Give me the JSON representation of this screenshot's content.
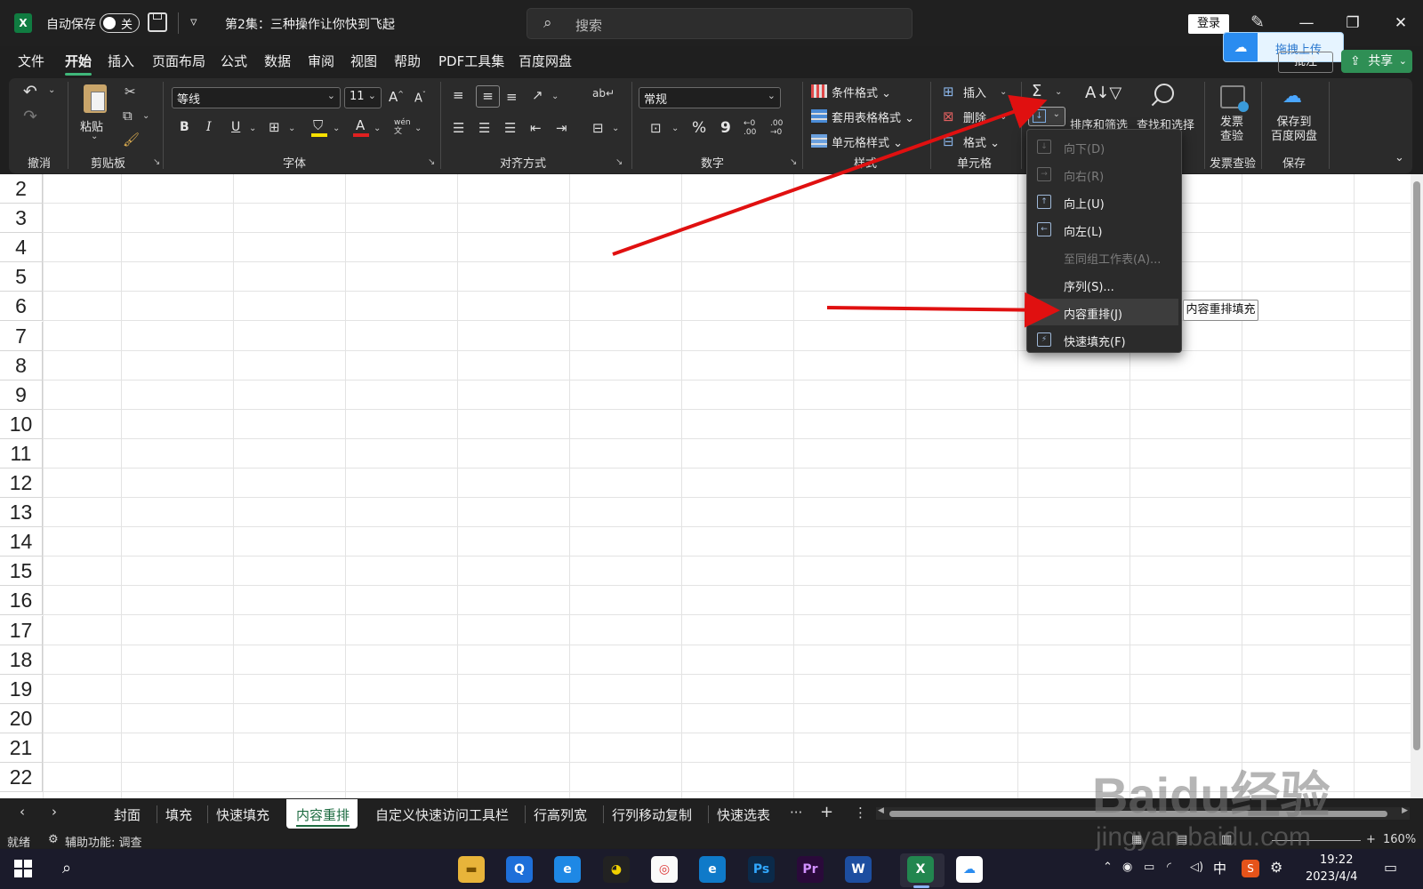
{
  "titlebar": {
    "logo": "X",
    "autosave_label": "自动保存",
    "autosave_state": "关",
    "document_title": "第2集：三种操作让你快到飞起",
    "search_placeholder": "搜索",
    "login_label": "登录",
    "minimize": "—",
    "restore": "❐",
    "close": "✕"
  },
  "menu_tabs": [
    "文件",
    "开始",
    "插入",
    "页面布局",
    "公式",
    "数据",
    "审阅",
    "视图",
    "帮助",
    "PDF工具集",
    "百度网盘"
  ],
  "active_tab": "开始",
  "baidu_popup": {
    "label": "拖拽上传"
  },
  "comment_button": "批注",
  "share_button": "共享",
  "ribbon": {
    "groups": {
      "undo": "撤消",
      "clipboard": "剪贴板",
      "font": "字体",
      "alignment": "对齐方式",
      "number": "数字",
      "styles": "样式",
      "cells": "单元格",
      "invoice": "发票查验",
      "save": "保存"
    },
    "paste_label": "粘贴",
    "font_name": "等线",
    "font_size": "11",
    "number_format": "常规",
    "conditional_format": "条件格式",
    "table_format": "套用表格格式",
    "cell_styles": "单元格样式",
    "insert": "插入",
    "delete": "删除",
    "format": "格式",
    "sort_filter": "排序和筛选",
    "find_select": "查找和选择",
    "invoice_line1": "发票",
    "invoice_line2": "查验",
    "save_baidu_line1": "保存到",
    "save_baidu_line2": "百度网盘",
    "bold": "B",
    "italic": "I",
    "underline": "U",
    "percent": "%",
    "comma": "9"
  },
  "fill_menu": {
    "items": [
      {
        "label": "向下(D)",
        "disabled": true
      },
      {
        "label": "向右(R)",
        "disabled": true
      },
      {
        "label": "向上(U)",
        "disabled": false
      },
      {
        "label": "向左(L)",
        "disabled": false
      },
      {
        "label": "至同组工作表(A)...",
        "disabled": true
      },
      {
        "label": "序列(S)...",
        "disabled": false
      },
      {
        "label": "内容重排(J)",
        "disabled": false
      },
      {
        "label": "快速填充(F)",
        "disabled": false
      }
    ],
    "tooltip": "内容重排填充"
  },
  "row_numbers": [
    "2",
    "3",
    "4",
    "5",
    "6",
    "7",
    "8",
    "9",
    "10",
    "11",
    "12",
    "13",
    "14",
    "15",
    "16",
    "17",
    "18",
    "19",
    "20",
    "21",
    "22"
  ],
  "sheet_tabs": [
    "封面",
    "填充",
    "快速填充",
    "内容重排",
    "自定义快速访问工具栏",
    "行高列宽",
    "行列移动复制",
    "快速选表"
  ],
  "active_sheet": "内容重排",
  "sheet_more": "···",
  "sheet_add": "+",
  "status": {
    "ready": "就绪",
    "accessibility": "辅助功能: 调查",
    "zoom": "160%"
  },
  "taskbar": {
    "apps": [
      "folder",
      "search-app",
      "edge-legacy",
      "qq",
      "chrome",
      "edge",
      "Ps",
      "Pr",
      "W",
      "X",
      "baidu-netdisk"
    ],
    "ime": "中",
    "time": "19:22",
    "date": "2023/4/4"
  },
  "watermark": {
    "brand": "Baidu经验",
    "url": "jingyan.baidu.com"
  },
  "colors": {
    "accent_green": "#107c41",
    "arrow_red": "#e01010",
    "ribbon_bg": "#2b2b2b"
  }
}
